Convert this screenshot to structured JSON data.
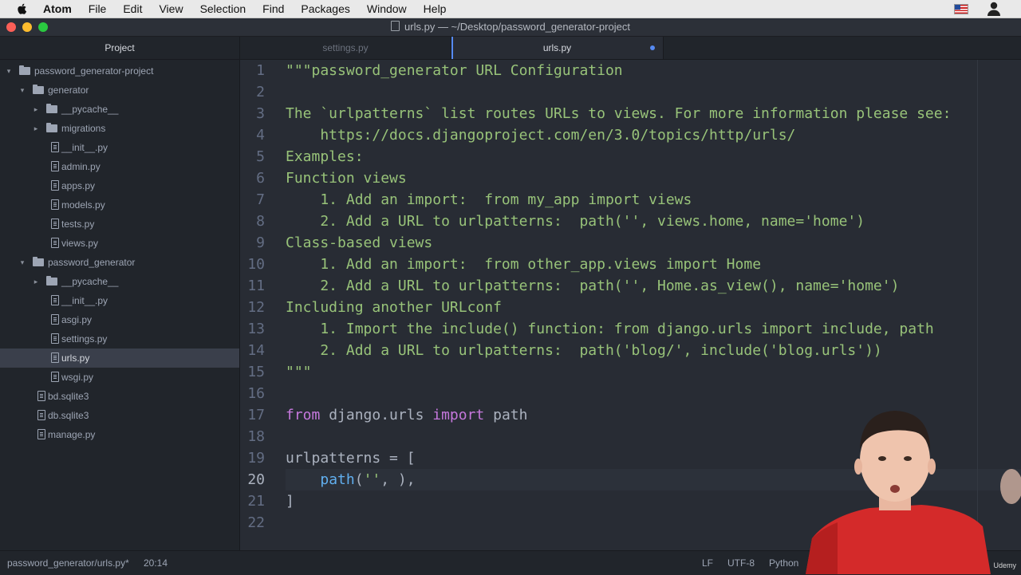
{
  "menubar": {
    "items": [
      "Atom",
      "File",
      "Edit",
      "View",
      "Selection",
      "Find",
      "Packages",
      "Window",
      "Help"
    ],
    "icons": [
      "apple-icon",
      "flag-icon",
      "user-icon"
    ]
  },
  "window": {
    "title": "urls.py — ~/Desktop/password_generator-project"
  },
  "sidebar": {
    "title": "Project",
    "tree": [
      {
        "label": "password_generator-project",
        "type": "folder",
        "depth": 0,
        "expanded": true
      },
      {
        "label": "generator",
        "type": "folder",
        "depth": 1,
        "expanded": true
      },
      {
        "label": "__pycache__",
        "type": "folder",
        "depth": 2,
        "expanded": false
      },
      {
        "label": "migrations",
        "type": "folder",
        "depth": 2,
        "expanded": false
      },
      {
        "label": "__init__.py",
        "type": "file",
        "depth": 2
      },
      {
        "label": "admin.py",
        "type": "file",
        "depth": 2
      },
      {
        "label": "apps.py",
        "type": "file",
        "depth": 2
      },
      {
        "label": "models.py",
        "type": "file",
        "depth": 2
      },
      {
        "label": "tests.py",
        "type": "file",
        "depth": 2
      },
      {
        "label": "views.py",
        "type": "file",
        "depth": 2
      },
      {
        "label": "password_generator",
        "type": "folder",
        "depth": 1,
        "expanded": true
      },
      {
        "label": "__pycache__",
        "type": "folder",
        "depth": 2,
        "expanded": false
      },
      {
        "label": "__init__.py",
        "type": "file",
        "depth": 2
      },
      {
        "label": "asgi.py",
        "type": "file",
        "depth": 2
      },
      {
        "label": "settings.py",
        "type": "file",
        "depth": 2
      },
      {
        "label": "urls.py",
        "type": "file",
        "depth": 2,
        "selected": true
      },
      {
        "label": "wsgi.py",
        "type": "file",
        "depth": 2
      },
      {
        "label": "bd.sqlite3",
        "type": "file",
        "depth": 1
      },
      {
        "label": "db.sqlite3",
        "type": "file",
        "depth": 1
      },
      {
        "label": "manage.py",
        "type": "file",
        "depth": 1
      }
    ]
  },
  "tabs": [
    {
      "label": "settings.py",
      "active": false
    },
    {
      "label": "urls.py",
      "active": true,
      "modified": true
    }
  ],
  "editor": {
    "current_line": 20,
    "lines": [
      [
        [
          "s",
          "\"\"\"password_generator URL Configuration"
        ]
      ],
      [],
      [
        [
          "s",
          "The `urlpatterns` list routes URLs to views. For more information please see:"
        ]
      ],
      [
        [
          "s",
          "    https://docs.djangoproject.com/en/3.0/topics/http/urls/"
        ]
      ],
      [
        [
          "s",
          "Examples:"
        ]
      ],
      [
        [
          "s",
          "Function views"
        ]
      ],
      [
        [
          "s",
          "    1. Add an import:  from my_app import views"
        ]
      ],
      [
        [
          "s",
          "    2. Add a URL to urlpatterns:  path('', views.home, name='home')"
        ]
      ],
      [
        [
          "s",
          "Class-based views"
        ]
      ],
      [
        [
          "s",
          "    1. Add an import:  from other_app.views import Home"
        ]
      ],
      [
        [
          "s",
          "    2. Add a URL to urlpatterns:  path('', Home.as_view(), name='home')"
        ]
      ],
      [
        [
          "s",
          "Including another URLconf"
        ]
      ],
      [
        [
          "s",
          "    1. Import the include() function: from django.urls import include, path"
        ]
      ],
      [
        [
          "s",
          "    2. Add a URL to urlpatterns:  path('blog/', include('blog.urls'))"
        ]
      ],
      [
        [
          "s",
          "\"\"\""
        ]
      ],
      [],
      [
        [
          "k",
          "from"
        ],
        [
          "p",
          " django.urls "
        ],
        [
          "k",
          "import"
        ],
        [
          "p",
          " path"
        ]
      ],
      [],
      [
        [
          "p",
          "urlpatterns = ["
        ]
      ],
      [
        [
          "p",
          "    "
        ],
        [
          "f",
          "path"
        ],
        [
          "p",
          "("
        ],
        [
          "s",
          "''"
        ],
        [
          "p",
          ", ),"
        ]
      ],
      [
        [
          "p",
          "]"
        ]
      ],
      []
    ]
  },
  "statusbar": {
    "path": "password_generator/urls.py*",
    "cursor": "20:14",
    "line_ending": "LF",
    "encoding": "UTF-8",
    "grammar": "Python"
  },
  "overlay": {
    "brand": "Udemy"
  },
  "colors": {
    "accent": "#568af2",
    "string": "#98c379",
    "keyword": "#c678dd",
    "function": "#61afef",
    "editor_bg": "#282c34",
    "sidebar_bg": "#21252b"
  }
}
